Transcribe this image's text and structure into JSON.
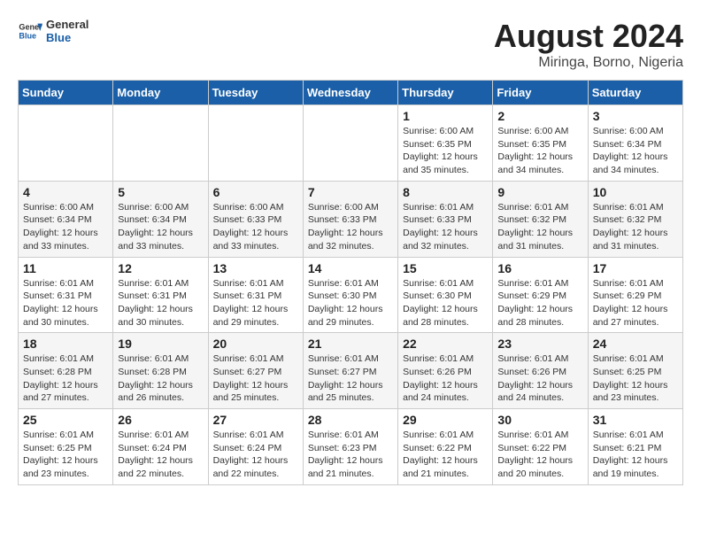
{
  "header": {
    "logo_line1": "General",
    "logo_line2": "Blue",
    "month_year": "August 2024",
    "location": "Miringa, Borno, Nigeria"
  },
  "weekdays": [
    "Sunday",
    "Monday",
    "Tuesday",
    "Wednesday",
    "Thursday",
    "Friday",
    "Saturday"
  ],
  "weeks": [
    [
      {
        "day": "",
        "info": ""
      },
      {
        "day": "",
        "info": ""
      },
      {
        "day": "",
        "info": ""
      },
      {
        "day": "",
        "info": ""
      },
      {
        "day": "1",
        "info": "Sunrise: 6:00 AM\nSunset: 6:35 PM\nDaylight: 12 hours\nand 35 minutes."
      },
      {
        "day": "2",
        "info": "Sunrise: 6:00 AM\nSunset: 6:35 PM\nDaylight: 12 hours\nand 34 minutes."
      },
      {
        "day": "3",
        "info": "Sunrise: 6:00 AM\nSunset: 6:34 PM\nDaylight: 12 hours\nand 34 minutes."
      }
    ],
    [
      {
        "day": "4",
        "info": "Sunrise: 6:00 AM\nSunset: 6:34 PM\nDaylight: 12 hours\nand 33 minutes."
      },
      {
        "day": "5",
        "info": "Sunrise: 6:00 AM\nSunset: 6:34 PM\nDaylight: 12 hours\nand 33 minutes."
      },
      {
        "day": "6",
        "info": "Sunrise: 6:00 AM\nSunset: 6:33 PM\nDaylight: 12 hours\nand 33 minutes."
      },
      {
        "day": "7",
        "info": "Sunrise: 6:00 AM\nSunset: 6:33 PM\nDaylight: 12 hours\nand 32 minutes."
      },
      {
        "day": "8",
        "info": "Sunrise: 6:01 AM\nSunset: 6:33 PM\nDaylight: 12 hours\nand 32 minutes."
      },
      {
        "day": "9",
        "info": "Sunrise: 6:01 AM\nSunset: 6:32 PM\nDaylight: 12 hours\nand 31 minutes."
      },
      {
        "day": "10",
        "info": "Sunrise: 6:01 AM\nSunset: 6:32 PM\nDaylight: 12 hours\nand 31 minutes."
      }
    ],
    [
      {
        "day": "11",
        "info": "Sunrise: 6:01 AM\nSunset: 6:31 PM\nDaylight: 12 hours\nand 30 minutes."
      },
      {
        "day": "12",
        "info": "Sunrise: 6:01 AM\nSunset: 6:31 PM\nDaylight: 12 hours\nand 30 minutes."
      },
      {
        "day": "13",
        "info": "Sunrise: 6:01 AM\nSunset: 6:31 PM\nDaylight: 12 hours\nand 29 minutes."
      },
      {
        "day": "14",
        "info": "Sunrise: 6:01 AM\nSunset: 6:30 PM\nDaylight: 12 hours\nand 29 minutes."
      },
      {
        "day": "15",
        "info": "Sunrise: 6:01 AM\nSunset: 6:30 PM\nDaylight: 12 hours\nand 28 minutes."
      },
      {
        "day": "16",
        "info": "Sunrise: 6:01 AM\nSunset: 6:29 PM\nDaylight: 12 hours\nand 28 minutes."
      },
      {
        "day": "17",
        "info": "Sunrise: 6:01 AM\nSunset: 6:29 PM\nDaylight: 12 hours\nand 27 minutes."
      }
    ],
    [
      {
        "day": "18",
        "info": "Sunrise: 6:01 AM\nSunset: 6:28 PM\nDaylight: 12 hours\nand 27 minutes."
      },
      {
        "day": "19",
        "info": "Sunrise: 6:01 AM\nSunset: 6:28 PM\nDaylight: 12 hours\nand 26 minutes."
      },
      {
        "day": "20",
        "info": "Sunrise: 6:01 AM\nSunset: 6:27 PM\nDaylight: 12 hours\nand 25 minutes."
      },
      {
        "day": "21",
        "info": "Sunrise: 6:01 AM\nSunset: 6:27 PM\nDaylight: 12 hours\nand 25 minutes."
      },
      {
        "day": "22",
        "info": "Sunrise: 6:01 AM\nSunset: 6:26 PM\nDaylight: 12 hours\nand 24 minutes."
      },
      {
        "day": "23",
        "info": "Sunrise: 6:01 AM\nSunset: 6:26 PM\nDaylight: 12 hours\nand 24 minutes."
      },
      {
        "day": "24",
        "info": "Sunrise: 6:01 AM\nSunset: 6:25 PM\nDaylight: 12 hours\nand 23 minutes."
      }
    ],
    [
      {
        "day": "25",
        "info": "Sunrise: 6:01 AM\nSunset: 6:25 PM\nDaylight: 12 hours\nand 23 minutes."
      },
      {
        "day": "26",
        "info": "Sunrise: 6:01 AM\nSunset: 6:24 PM\nDaylight: 12 hours\nand 22 minutes."
      },
      {
        "day": "27",
        "info": "Sunrise: 6:01 AM\nSunset: 6:24 PM\nDaylight: 12 hours\nand 22 minutes."
      },
      {
        "day": "28",
        "info": "Sunrise: 6:01 AM\nSunset: 6:23 PM\nDaylight: 12 hours\nand 21 minutes."
      },
      {
        "day": "29",
        "info": "Sunrise: 6:01 AM\nSunset: 6:22 PM\nDaylight: 12 hours\nand 21 minutes."
      },
      {
        "day": "30",
        "info": "Sunrise: 6:01 AM\nSunset: 6:22 PM\nDaylight: 12 hours\nand 20 minutes."
      },
      {
        "day": "31",
        "info": "Sunrise: 6:01 AM\nSunset: 6:21 PM\nDaylight: 12 hours\nand 19 minutes."
      }
    ]
  ]
}
